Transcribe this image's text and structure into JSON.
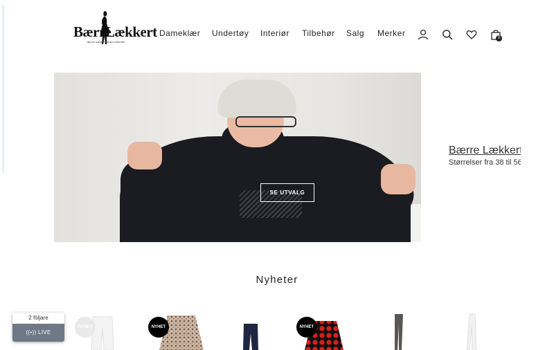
{
  "brand": {
    "name_left": "Bærre",
    "name_right": "Lækkert",
    "tagline": "tøy for voksne damer m/former"
  },
  "nav": {
    "items": [
      "Dameklær",
      "Undertøy",
      "Interiør",
      "Tilbehør",
      "Salg",
      "Merker"
    ]
  },
  "header_icons": {
    "account": "user-icon",
    "search": "search-icon",
    "wishlist": "heart-icon",
    "cart": "bag-icon",
    "cart_count": "0"
  },
  "hero": {
    "cta_label": "SE UTVALG",
    "next_slide_title": "Bærre Lækkert",
    "next_slide_subtitle": "Størrelser fra 38 til 56"
  },
  "section": {
    "title": "Nyheter"
  },
  "products": {
    "badge_label": "NYHET"
  },
  "live_widget": {
    "followers": "2 följare",
    "live_label": "LIVE"
  }
}
